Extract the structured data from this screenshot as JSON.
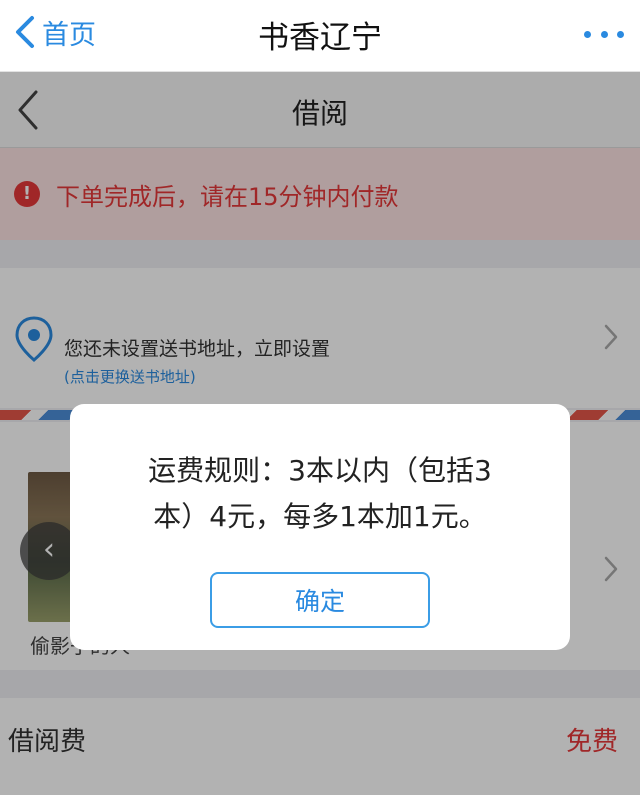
{
  "topbar": {
    "back_label": "首页",
    "title": "书香辽宁"
  },
  "page": {
    "title": "借阅",
    "notice": "下单完成后，请在15分钟内付款",
    "address": {
      "main": "您还未设置送书地址，立即设置",
      "sub": "(点击更换送书地址)"
    },
    "book": {
      "title": "偷影子的人"
    },
    "fee": {
      "label": "借阅费",
      "value": "免费"
    }
  },
  "modal": {
    "message_line1": "运费规则：3本以内（包括3",
    "message_line2": "本）4元，每多1本加1元。",
    "confirm_label": "确定"
  },
  "colors": {
    "accent": "#2a8ae0",
    "alert": "#e6383a",
    "notice_bg": "#fde3e2"
  }
}
